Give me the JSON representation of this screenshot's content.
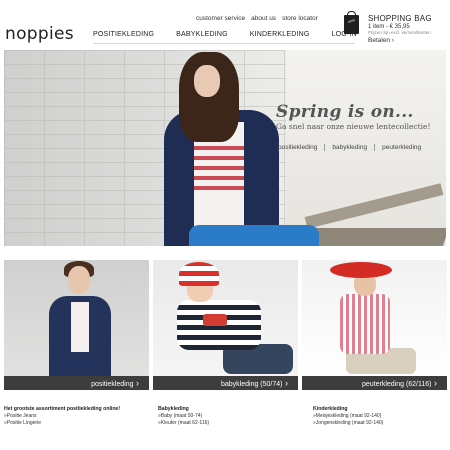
{
  "brand": {
    "logo": "noppies"
  },
  "utility_nav": [
    "customer service",
    "about us",
    "store locator"
  ],
  "main_nav": [
    "POSITIEKLEDING",
    "BABYKLEDING",
    "KINDERKLEDING",
    "LOG-IN"
  ],
  "shopping_bag": {
    "title": "SHOPPING BAG",
    "items": "1 item - € 35,95",
    "shipping": "Prijzen zijn excl. verzendkosten",
    "pay": "Betalen"
  },
  "hero": {
    "title": "Spring is on...",
    "subtitle": "Ga snel naar onze nieuwe lentecollectie!",
    "links": [
      "positiekleding",
      "babykleding",
      "peuterkleding"
    ]
  },
  "tiles": [
    {
      "label": "positiekleding"
    },
    {
      "label": "babykleding (50/74)"
    },
    {
      "label": "peuterkleding (62/116)"
    }
  ],
  "footer_columns": [
    {
      "title": "Het grootste assortiment positiekleding online!",
      "links": [
        "Positie Jeans",
        "Positie Lingerie"
      ]
    },
    {
      "title": "Babykleding",
      "links": [
        "Baby (maat 50-74)",
        "Kleuter (maat 62-116)"
      ]
    },
    {
      "title": "Kinderkleding",
      "links": [
        "Meisjeskleding (maat 92-140)",
        "Jongenskleding (maat 92-140)"
      ]
    }
  ],
  "colors": {
    "tile_bar": "#3d3d3d",
    "hero_title": "#555555",
    "accent_red": "#d33b35"
  }
}
